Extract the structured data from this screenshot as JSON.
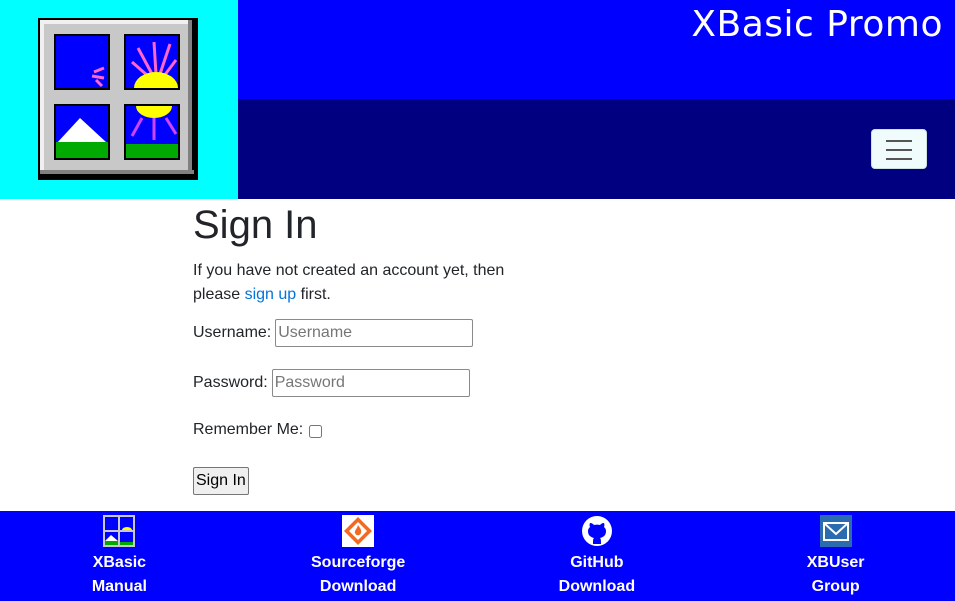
{
  "header": {
    "site_title": "XBasic Promo",
    "logo_icon": "xbasic-window-logo",
    "menu_icon": "hamburger-icon"
  },
  "signin": {
    "title": "Sign In",
    "intro_before": "If you have not created an account yet, then please ",
    "signup_link": "sign up",
    "intro_after": " first.",
    "username_label": "Username:",
    "username_placeholder": "Username",
    "username_value": "",
    "password_label": "Password:",
    "password_placeholder": "Password",
    "password_value": "",
    "remember_label": "Remember Me:",
    "remember_checked": false,
    "submit_label": "Sign In"
  },
  "footer": {
    "links": [
      {
        "line1": "XBasic",
        "line2": "Manual",
        "icon": "xbasic-manual-icon"
      },
      {
        "line1": "Sourceforge",
        "line2": "Download",
        "icon": "sourceforge-icon"
      },
      {
        "line1": "GitHub",
        "line2": "Download",
        "icon": "github-icon"
      },
      {
        "line1": "XBUser",
        "line2": "Group",
        "icon": "mail-icon"
      }
    ]
  },
  "colors": {
    "logo_bg": "#00ffff",
    "title_bar": "#0000ff",
    "nav_bar": "#000080",
    "footer_bg": "#0000ff",
    "link": "#0074d9"
  }
}
